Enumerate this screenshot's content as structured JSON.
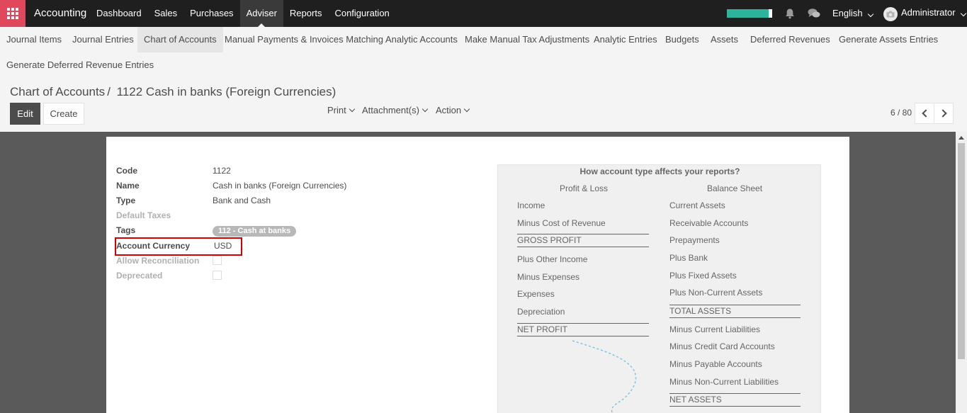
{
  "topbar": {
    "brand": "Accounting",
    "menu": [
      "Dashboard",
      "Sales",
      "Purchases",
      "Adviser",
      "Reports",
      "Configuration"
    ],
    "active_menu": "Adviser",
    "language": "English",
    "user": "Administrator",
    "colors": {
      "bar": "#1f1f1f",
      "apps": "#e0485e",
      "progress": "#2bb39b"
    }
  },
  "submenu": {
    "row1": [
      "Journal Items",
      "Journal Entries",
      "Chart of Accounts",
      "Manual Payments & Invoices Matching",
      "Analytic Accounts",
      "Make Manual Tax Adjustments",
      "Analytic Entries",
      "Budgets",
      "Assets",
      "Deferred Revenues",
      "Generate Assets Entries"
    ],
    "row2": [
      "Generate Deferred Revenue Entries"
    ],
    "active": "Chart of Accounts"
  },
  "breadcrumb": {
    "parent": "Chart of Accounts",
    "separator": "/",
    "current": "1122 Cash in banks (Foreign Currencies)"
  },
  "buttons": {
    "edit": "Edit",
    "create": "Create"
  },
  "dropdowns": {
    "print": "Print",
    "attachments": "Attachment(s)",
    "action": "Action"
  },
  "pager": {
    "value": "6 / 80"
  },
  "form": {
    "code": {
      "label": "Code",
      "value": "1122"
    },
    "name": {
      "label": "Name",
      "value": "Cash in banks (Foreign Currencies)"
    },
    "type": {
      "label": "Type",
      "value": "Bank and Cash"
    },
    "default_taxes": {
      "label": "Default Taxes",
      "value": ""
    },
    "tags": {
      "label": "Tags",
      "value": "112 - Cash at banks"
    },
    "account_currency": {
      "label": "Account Currency",
      "value": "USD"
    },
    "allow_reconciliation": {
      "label": "Allow Reconciliation",
      "checked": false
    },
    "deprecated": {
      "label": "Deprecated",
      "checked": false
    }
  },
  "help": {
    "title": "How account type affects your reports?",
    "pl_heading": "Profit & Loss",
    "bs_heading": "Balance Sheet",
    "pl_items": [
      "Income",
      "Minus Cost of Revenue",
      "GROSS PROFIT",
      "Plus Other Income",
      "Minus Expenses",
      "Expenses",
      "Depreciation",
      "NET PROFIT"
    ],
    "bs_items": [
      "Current Assets",
      "Receivable Accounts",
      "Prepayments",
      "Plus Bank",
      "Plus Fixed Assets",
      "Plus Non-Current Assets",
      "TOTAL ASSETS",
      "Minus Current Liabilities",
      "Minus Credit Card Accounts",
      "Minus Payable Accounts",
      "Minus Non-Current Liabilities",
      "NET ASSETS"
    ]
  }
}
